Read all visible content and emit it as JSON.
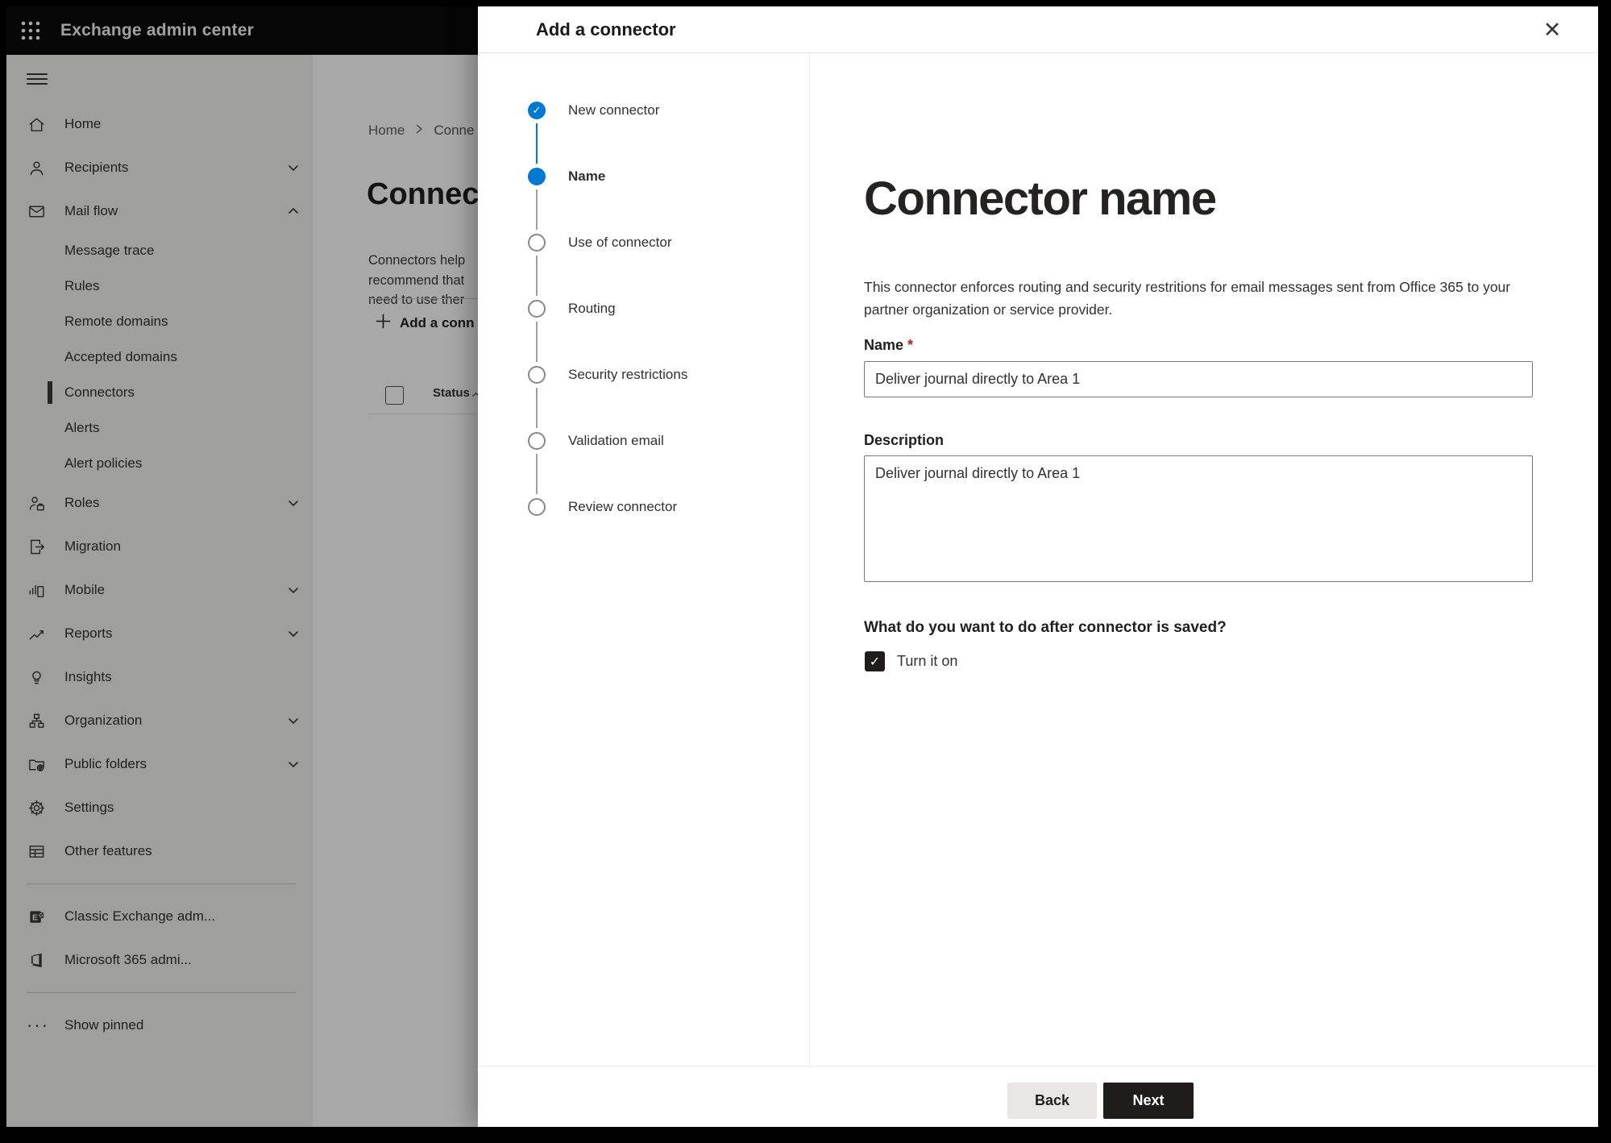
{
  "app": {
    "title": "Exchange admin center"
  },
  "icons": {
    "check": "✓",
    "close": "✕",
    "plus": "+",
    "ellipsis": "···"
  },
  "colors": {
    "accent_blue": "#0078d4",
    "dark_button": "#1e1d1c",
    "required_red": "#a4262c",
    "topbar_black": "#0a0a0a",
    "sidebar_gray": "#f2f1ef"
  },
  "sidebar": {
    "items": [
      {
        "label": "Home",
        "type": "top",
        "icon": "home",
        "chevron": null,
        "selected": false
      },
      {
        "label": "Recipients",
        "type": "top",
        "icon": "person",
        "chevron": "down",
        "selected": false
      },
      {
        "label": "Mail flow",
        "type": "top",
        "icon": "mail",
        "chevron": "up",
        "selected": false
      },
      {
        "label": "Message trace",
        "type": "sub",
        "icon": null,
        "chevron": null,
        "selected": false
      },
      {
        "label": "Rules",
        "type": "sub",
        "icon": null,
        "chevron": null,
        "selected": false
      },
      {
        "label": "Remote domains",
        "type": "sub",
        "icon": null,
        "chevron": null,
        "selected": false
      },
      {
        "label": "Accepted domains",
        "type": "sub",
        "icon": null,
        "chevron": null,
        "selected": false
      },
      {
        "label": "Connectors",
        "type": "sub",
        "icon": null,
        "chevron": null,
        "selected": true
      },
      {
        "label": "Alerts",
        "type": "sub",
        "icon": null,
        "chevron": null,
        "selected": false
      },
      {
        "label": "Alert policies",
        "type": "sub",
        "icon": null,
        "chevron": null,
        "selected": false
      },
      {
        "label": "Roles",
        "type": "top",
        "icon": "roles",
        "chevron": "down",
        "selected": false
      },
      {
        "label": "Migration",
        "type": "top",
        "icon": "migration",
        "chevron": null,
        "selected": false
      },
      {
        "label": "Mobile",
        "type": "top",
        "icon": "mobile",
        "chevron": "down",
        "selected": false
      },
      {
        "label": "Reports",
        "type": "top",
        "icon": "reports",
        "chevron": "down",
        "selected": false
      },
      {
        "label": "Insights",
        "type": "top",
        "icon": "lightbulb",
        "chevron": null,
        "selected": false
      },
      {
        "label": "Organization",
        "type": "top",
        "icon": "org-tree",
        "chevron": "down",
        "selected": false
      },
      {
        "label": "Public folders",
        "type": "top",
        "icon": "folder-globe",
        "chevron": "down",
        "selected": false
      },
      {
        "label": "Settings",
        "type": "top",
        "icon": "gear",
        "chevron": null,
        "selected": false
      },
      {
        "label": "Other features",
        "type": "top",
        "icon": "grid-table",
        "chevron": null,
        "selected": false
      }
    ],
    "footer_items": [
      {
        "label": "Classic Exchange adm...",
        "icon": "exchange-logo"
      },
      {
        "label": "Microsoft 365 admi...",
        "icon": "office-logo"
      }
    ],
    "show_pinned_label": "Show pinned"
  },
  "background_page": {
    "breadcrumb": {
      "home": "Home",
      "current": "Conne"
    },
    "page_title": "Connect",
    "intro_lines": "Connectors help\nrecommend that\nneed to use ther",
    "add_button_label": "Add a conn",
    "table": {
      "status_header": "Status"
    }
  },
  "wizard": {
    "title": "Add a connector",
    "steps": [
      {
        "label": "New connector",
        "state": "done"
      },
      {
        "label": "Name",
        "state": "current"
      },
      {
        "label": "Use of connector",
        "state": "todo"
      },
      {
        "label": "Routing",
        "state": "todo"
      },
      {
        "label": "Security restrictions",
        "state": "todo"
      },
      {
        "label": "Validation email",
        "state": "todo"
      },
      {
        "label": "Review connector",
        "state": "todo"
      }
    ],
    "page": {
      "heading": "Connector name",
      "description": "This connector enforces routing and security restritions for email messages sent from Office 365 to your partner organization or service provider.",
      "name_label": "Name",
      "required_mark": "*",
      "name_value": "Deliver journal directly to Area 1",
      "description_label": "Description",
      "description_value": "Deliver journal directly to Area 1",
      "after_save_question": "What do you want to do after connector is saved?",
      "turn_on_label": "Turn it on",
      "turn_on_checked": true
    },
    "footer": {
      "back_label": "Back",
      "next_label": "Next"
    }
  }
}
